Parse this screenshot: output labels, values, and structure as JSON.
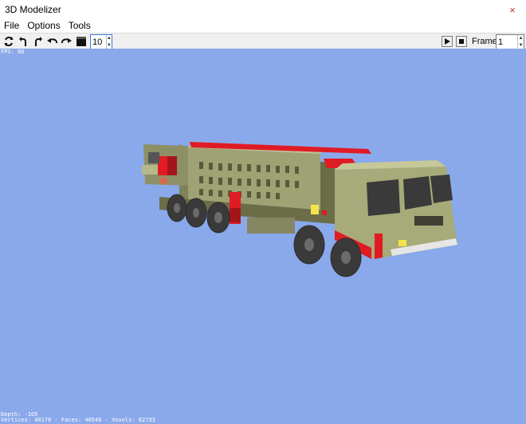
{
  "window": {
    "title": "3D Modelizer",
    "close_icon": "×"
  },
  "menu": {
    "items": [
      "File",
      "Options",
      "Tools"
    ]
  },
  "toolbar": {
    "icons": [
      "refresh-icon",
      "rotate-left-icon",
      "rotate-right-icon",
      "undo-icon",
      "redo-icon",
      "background-color-icon"
    ],
    "zoom_value": "10",
    "frame_label": "Frame:",
    "frame_value": "1"
  },
  "viewport": {
    "background": "#8aa9ea",
    "fps": "FPS: 66",
    "depth": "Depth: -105",
    "stats": "Vertices: 40170 - Faces: 40546 - Voxels: 82733"
  },
  "colors": {
    "truck_body": "#a7aa79",
    "truck_accent": "#e01b24",
    "tire": "#3a3a3a"
  }
}
